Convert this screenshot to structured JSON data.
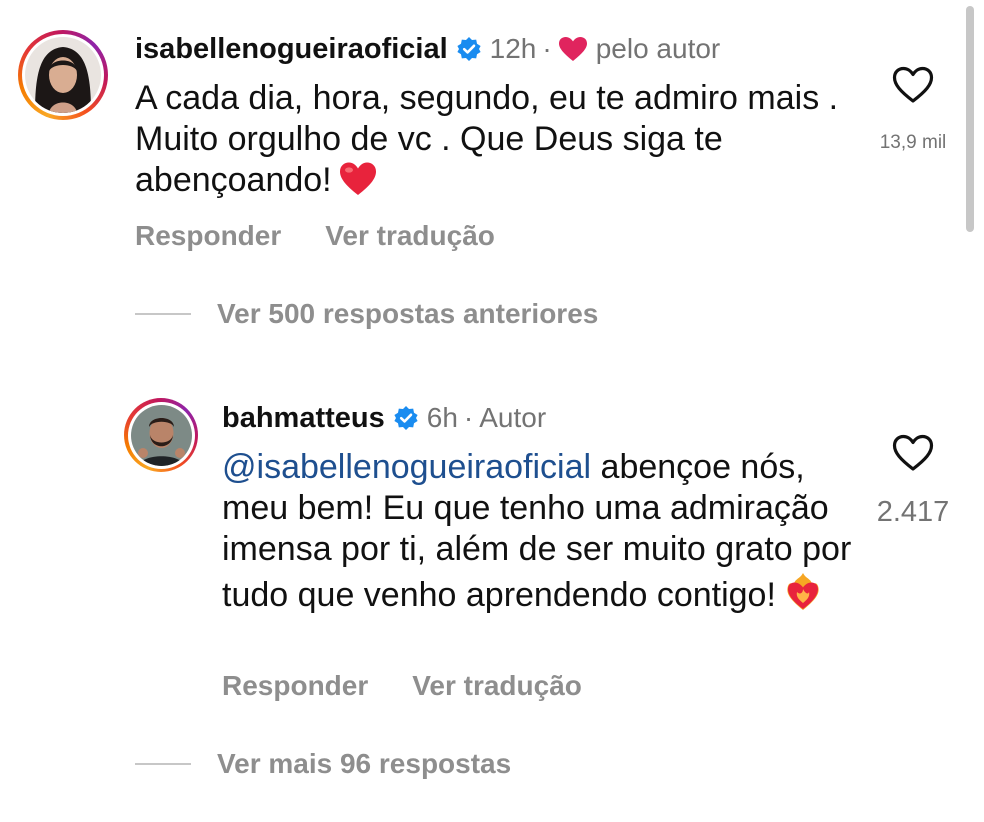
{
  "comment": {
    "username": "isabellenogueiraoficial",
    "time": "12h",
    "separator": "·",
    "liked_by_author_label": "pelo autor",
    "text": "A cada dia, hora, segundo, eu te admiro mais . Muito orgulho de vc . Que Deus siga te abençoando!",
    "text_emoji": "red-heart-emoji",
    "like_count": "13,9 mil",
    "reply_label": "Responder",
    "translate_label": "Ver tradução",
    "view_previous_replies_label": "Ver 500 respostas anteriores"
  },
  "reply": {
    "username": "bahmatteus",
    "time": "6h",
    "separator": "·",
    "author_badge": "Autor",
    "mention": "@isabellenogueiraoficial",
    "text": "abençoe nós, meu bem! Eu que tenho uma admiração imensa por ti, além de ser muito grato por tudo que venho aprendendo contigo!",
    "text_emoji": "heart-on-fire-emoji",
    "like_count": "2.417",
    "reply_label": "Responder",
    "translate_label": "Ver tradução",
    "view_more_replies_label": "Ver mais 96 respostas"
  },
  "colors": {
    "verified_badge": "#1a8cf0",
    "heart_red": "#e0245e",
    "secondary_text": "#737373",
    "action_text": "#8e8e8e",
    "mention": "#1e4f8f"
  },
  "icons": {
    "verified": "verified-badge-icon",
    "author_like": "heart-filled-icon",
    "like": "heart-outline-icon"
  }
}
